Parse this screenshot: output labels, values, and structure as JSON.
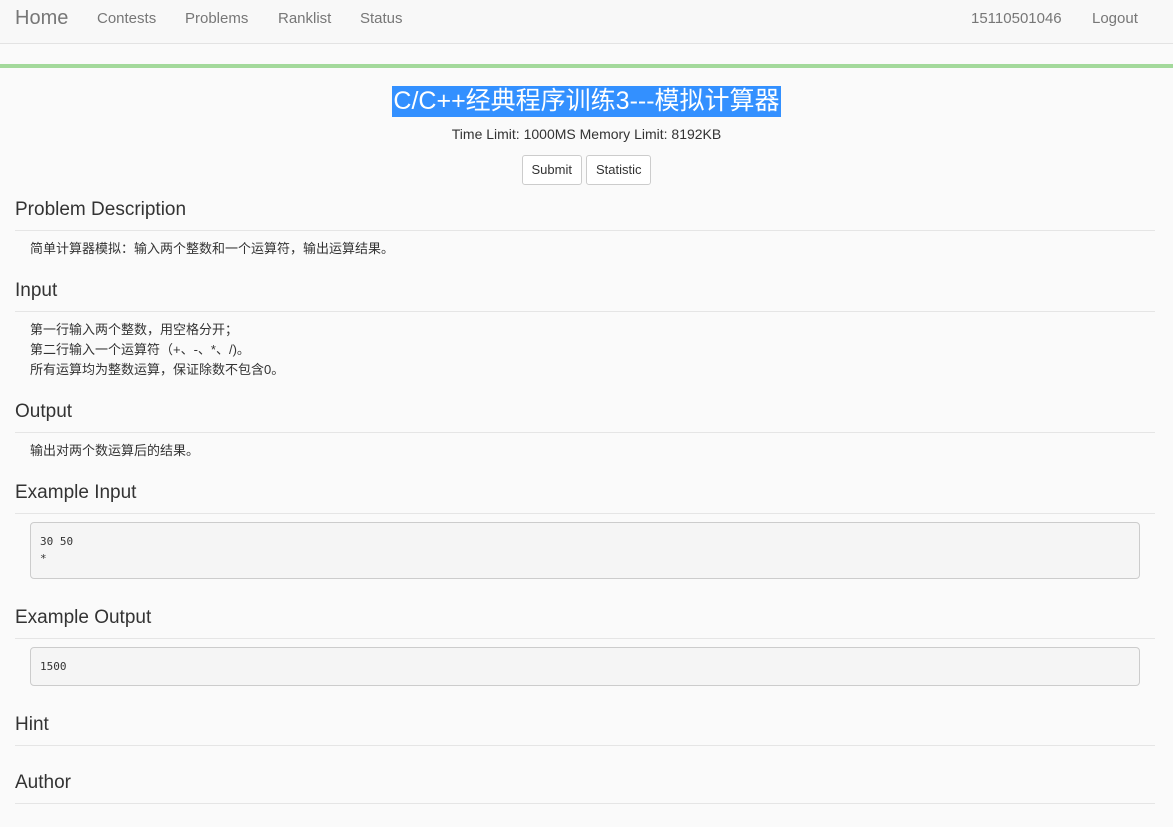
{
  "nav": {
    "brand": "Home",
    "items": [
      "Contests",
      "Problems",
      "Ranklist",
      "Status"
    ],
    "user": "15110501046",
    "logout": "Logout"
  },
  "problem": {
    "title": "C/C++经典程序训练3---模拟计算器",
    "limits": "Time Limit: 1000MS Memory Limit: 8192KB",
    "submit_label": "Submit",
    "statistic_label": "Statistic"
  },
  "sections": {
    "description": {
      "heading": "Problem Description",
      "text": "简单计算器模拟：输入两个整数和一个运算符，输出运算结果。"
    },
    "input": {
      "heading": "Input",
      "lines": [
        "第一行输入两个整数，用空格分开；",
        "第二行输入一个运算符（+、-、*、/)。",
        "所有运算均为整数运算，保证除数不包含0。"
      ]
    },
    "output": {
      "heading": "Output",
      "text": "输出对两个数运算后的结果。"
    },
    "example_input": {
      "heading": "Example Input",
      "lines": [
        "30 50",
        "*"
      ]
    },
    "example_output": {
      "heading": "Example Output",
      "text": "1500"
    },
    "hint": {
      "heading": "Hint"
    },
    "author": {
      "heading": "Author"
    }
  }
}
